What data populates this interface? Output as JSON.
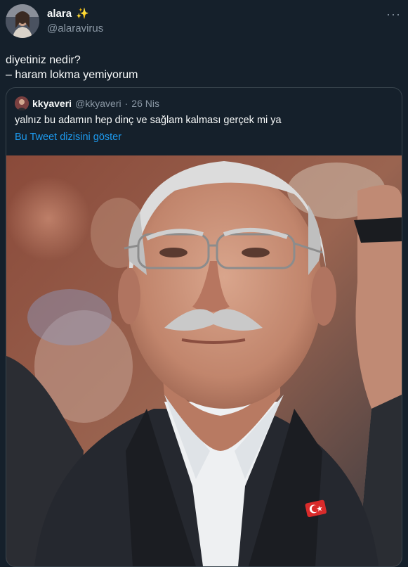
{
  "tweet": {
    "display_name": "alara",
    "sparkles_icon": "sparkles-icon",
    "handle": "@alaravirus",
    "more_icon": "more-icon",
    "text_line1": "diyetiniz nedir?",
    "text_line2": "– haram lokma yemiyorum"
  },
  "quoted": {
    "display_name": "kkyaveri",
    "handle": "@kkyaveri",
    "separator": "·",
    "date": "26 Nis",
    "text": "yalnız bu adamın hep dinç ve sağlam kalması gerçek mi ya",
    "thread_link": "Bu Tweet dizisini göster"
  },
  "colors": {
    "background": "#15202b",
    "secondary_text": "#8b98a5",
    "link": "#1d9bf0",
    "border": "#38444d"
  }
}
